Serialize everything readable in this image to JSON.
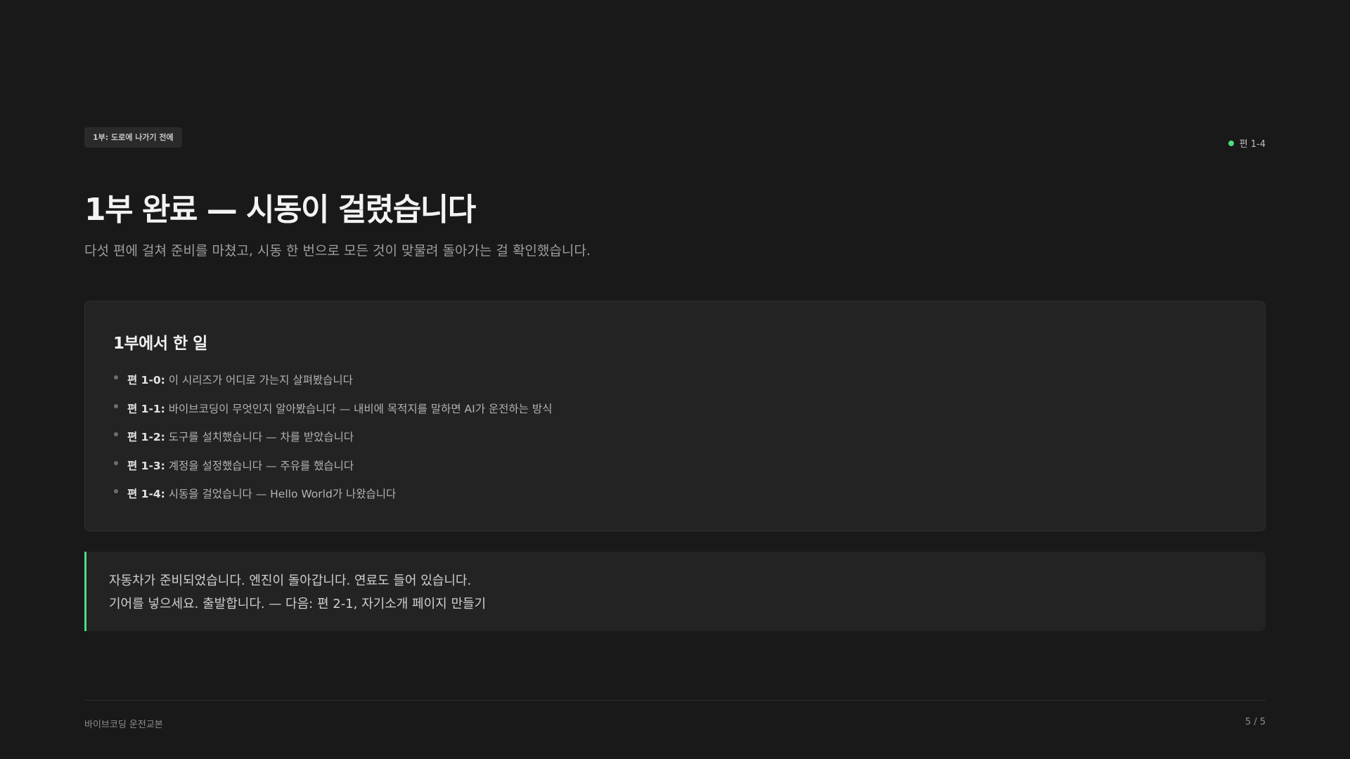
{
  "header": {
    "section_tag": "1부: 도로에 나가기 전에",
    "episode_indicator": "편 1-4"
  },
  "title": "1부 완료 — 시동이 걸렸습니다",
  "subtitle": "다섯 편에 걸쳐 준비를 마쳤고, 시동 한 번으로 모든 것이 맞물려 돌아가는 걸 확인했습니다.",
  "summary_card": {
    "heading": "1부에서 한 일",
    "items": [
      {
        "code": "편 1-0:",
        "text": " 이 시리즈가 어디로 가는지 살펴봤습니다"
      },
      {
        "code": "편 1-1:",
        "text": " 바이브코딩이 무엇인지 알아봤습니다 — 내비에 목적지를 말하면 AI가 운전하는 방식"
      },
      {
        "code": "편 1-2:",
        "text": " 도구를 설치했습니다 — 차를 받았습니다"
      },
      {
        "code": "편 1-3:",
        "text": " 계정을 설정했습니다 — 주유를 했습니다"
      },
      {
        "code": "편 1-4:",
        "text": " 시동을 걸었습니다 — Hello World가 나왔습니다"
      }
    ]
  },
  "callout": {
    "line1": "자동차가 준비되었습니다. 엔진이 돌아갑니다. 연료도 들어 있습니다.",
    "line2": "기어를 넣으세요. 출발합니다. — 다음: 편 2-1, 자기소개 페이지 만들기"
  },
  "footer": {
    "left": "바이브코딩 운전교본",
    "page": "5 / 5"
  },
  "colors": {
    "background": "#191919",
    "card": "#232323",
    "accent": "#4ade80"
  }
}
